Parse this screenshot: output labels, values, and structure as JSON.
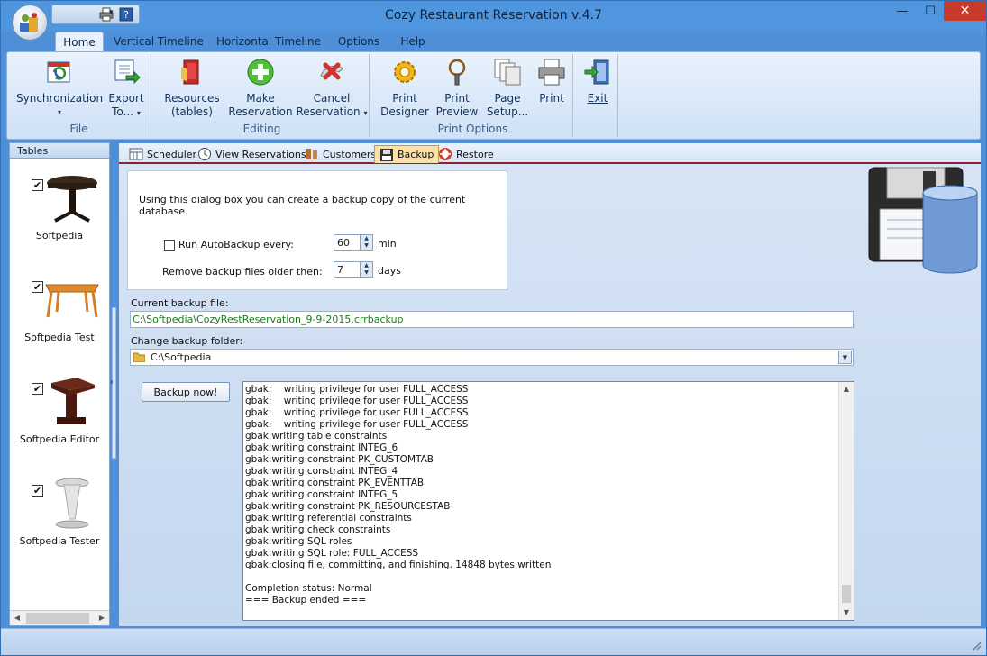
{
  "window": {
    "title": "Cozy Restaurant Reservation v.4.7",
    "minimize_glyph": "—",
    "maximize_glyph": "☐",
    "close_glyph": "✕"
  },
  "ribbon_tabs": [
    {
      "label": "Home",
      "active": true
    },
    {
      "label": "Vertical Timeline",
      "active": false
    },
    {
      "label": "Horizontal Timeline",
      "active": false
    },
    {
      "label": "Options",
      "active": false
    },
    {
      "label": "Help",
      "active": false
    }
  ],
  "groups": {
    "file": {
      "label": "File",
      "sync": {
        "line1": "Synchronization",
        "dd": "▾",
        "icon": "sync-icon"
      },
      "export": {
        "line1": "Export",
        "line2": "To...",
        "dd": "▾",
        "icon": "export-icon"
      }
    },
    "editing": {
      "label": "Editing",
      "resources": {
        "line1": "Resources",
        "line2": "(tables)",
        "icon": "resources-icon"
      },
      "make": {
        "line1": "Make",
        "line2": "Reservation",
        "icon": "add-icon"
      },
      "cancel": {
        "line1": "Cancel",
        "line2": "Reservation",
        "dd": "▾",
        "icon": "cancel-icon"
      }
    },
    "print": {
      "label": "Print Options",
      "designer": {
        "line1": "Print",
        "line2": "Designer",
        "icon": "gear-icon"
      },
      "preview": {
        "line1": "Print",
        "line2": "Preview",
        "icon": "magnifier-icon"
      },
      "page": {
        "line1": "Page",
        "line2": "Setup...",
        "icon": "page-setup-icon"
      },
      "print": {
        "line1": "Print",
        "icon": "printer-icon"
      }
    },
    "exit": {
      "label": "",
      "exit": {
        "line1": "Exit",
        "icon": "exit-door-icon"
      }
    }
  },
  "left_panel": {
    "header": "Tables",
    "items": [
      {
        "label": "Softpedia",
        "checked": true
      },
      {
        "label": "Softpedia Test",
        "checked": true
      },
      {
        "label": "Softpedia Editor",
        "checked": true
      },
      {
        "label": "Softpedia Tester",
        "checked": true
      }
    ],
    "check_glyph": "✔",
    "collapse_glyph": "‹"
  },
  "view_tabs": [
    {
      "label": "Scheduler",
      "icon": "scheduler-icon",
      "active": false
    },
    {
      "label": "View Reservations",
      "icon": "clock-icon",
      "active": false
    },
    {
      "label": "Customers",
      "icon": "customers-icon",
      "active": false
    },
    {
      "label": "Backup",
      "icon": "backup-icon",
      "active": true
    },
    {
      "label": "Restore",
      "icon": "restore-icon",
      "active": false
    }
  ],
  "backup": {
    "intro": "Using this dialog box you can create a backup copy of the current database.",
    "autobackup_label": "Run AutoBackup every:",
    "autobackup_checked": false,
    "autobackup_value": "60",
    "autobackup_unit": "min",
    "remove_label": "Remove backup files older then:",
    "remove_value": "7",
    "remove_unit": "days",
    "current_file_label": "Current backup file:",
    "current_file_value": "C:\\Softpedia\\CozyRestReservation_9-9-2015.crrbackup",
    "change_folder_label": "Change backup folder:",
    "folder_value": "C:\\Softpedia",
    "backup_button": "Backup now!",
    "log_lines": [
      "gbak:    writing privilege for user FULL_ACCESS",
      "gbak:    writing privilege for user FULL_ACCESS",
      "gbak:    writing privilege for user FULL_ACCESS",
      "gbak:    writing privilege for user FULL_ACCESS",
      "gbak:writing table constraints",
      "gbak:writing constraint INTEG_6",
      "gbak:writing constraint PK_CUSTOMTAB",
      "gbak:writing constraint INTEG_4",
      "gbak:writing constraint PK_EVENTTAB",
      "gbak:writing constraint INTEG_5",
      "gbak:writing constraint PK_RESOURCESTAB",
      "gbak:writing referential constraints",
      "gbak:writing check constraints",
      "gbak:writing SQL roles",
      "gbak:writing SQL role: FULL_ACCESS",
      "gbak:closing file, committing, and finishing. 14848 bytes written",
      "",
      "Completion status: Normal",
      "=== Backup ended ==="
    ]
  },
  "colors": {
    "window_frame": "#4f8fd8",
    "active_view_tab": "#fbe1a7",
    "accent_line": "#8a2236",
    "close_button": "#c83a2a",
    "path_text": "#1c7a1c"
  },
  "scroll": {
    "up": "▲",
    "down": "▼",
    "left": "◀",
    "right": "▶",
    "spin_up": "▲",
    "spin_down": "▼",
    "combo": "▼"
  }
}
